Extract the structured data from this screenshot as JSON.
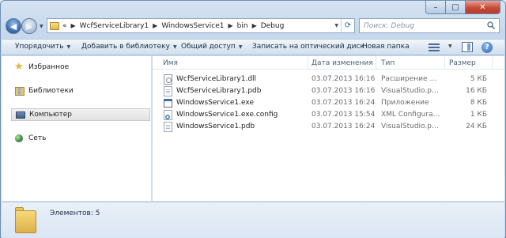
{
  "address": {
    "path": [
      "WcfServiceLibrary1",
      "WindowsService1",
      "bin",
      "Debug"
    ],
    "overflow": "«"
  },
  "search": {
    "placeholder": "Поиск: Debug"
  },
  "toolbar": {
    "organize": "Упорядочить",
    "add_to_library": "Добавить в библиотеку",
    "share": "Общий доступ",
    "burn": "Записать на оптический диск",
    "new_folder": "Новая папка"
  },
  "sidebar": {
    "items": [
      {
        "label": "Избранное",
        "icon": "star-icon"
      },
      {
        "label": "Библиотеки",
        "icon": "libraries-icon"
      },
      {
        "label": "Компьютер",
        "icon": "computer-icon",
        "selected": true
      },
      {
        "label": "Сеть",
        "icon": "network-icon"
      }
    ]
  },
  "columns": {
    "name": "Имя",
    "date": "Дата изменения",
    "type": "Тип",
    "size": "Размер"
  },
  "files": [
    {
      "name": "WcfServiceLibrary1.dll",
      "date": "03.07.2013 16:16",
      "type": "Расширение при...",
      "size": "5 КБ",
      "icon": "dll-file-icon"
    },
    {
      "name": "WcfServiceLibrary1.pdb",
      "date": "03.07.2013 16:16",
      "type": "VisualStudio.pdb....",
      "size": "16 КБ",
      "icon": "pdb-file-icon"
    },
    {
      "name": "WindowsService1.exe",
      "date": "03.07.2013 16:24",
      "type": "Приложение",
      "size": "8 КБ",
      "icon": "exe-file-icon"
    },
    {
      "name": "WindowsService1.exe.config",
      "date": "03.07.2013 15:54",
      "type": "XML Configuratio...",
      "size": "1 КБ",
      "icon": "config-file-icon"
    },
    {
      "name": "WindowsService1.pdb",
      "date": "03.07.2013 16:24",
      "type": "VisualStudio.pdb....",
      "size": "24 КБ",
      "icon": "pdb-file-icon"
    }
  ],
  "details": {
    "count_text": "Элементов: 5"
  },
  "caption": {
    "minimize": "–",
    "maximize": "□",
    "close": "✕"
  }
}
